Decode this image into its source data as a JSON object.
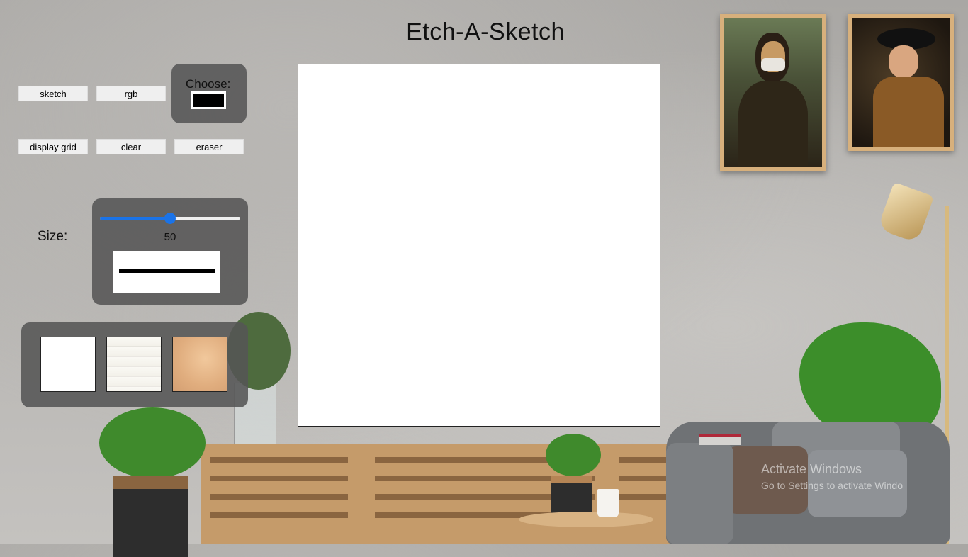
{
  "page_title": "Etch-A-Sketch",
  "controls": {
    "sketch_label": "sketch",
    "rgb_label": "rgb",
    "display_grid_label": "display grid",
    "clear_label": "clear",
    "eraser_label": "eraser"
  },
  "color_picker": {
    "label": "Choose:",
    "value": "#000000"
  },
  "size": {
    "label": "Size:",
    "value": "50",
    "min": 0,
    "max": 100,
    "level": 0.5
  },
  "backgrounds": [
    "white",
    "wood-planks",
    "paper"
  ],
  "overlay": {
    "activate_title": "Activate Windows",
    "activate_sub": "Go to Settings to activate Windo"
  },
  "colors": {
    "accent": "#1a73e8",
    "panel": "#555555",
    "frame": "#d7b07c"
  }
}
